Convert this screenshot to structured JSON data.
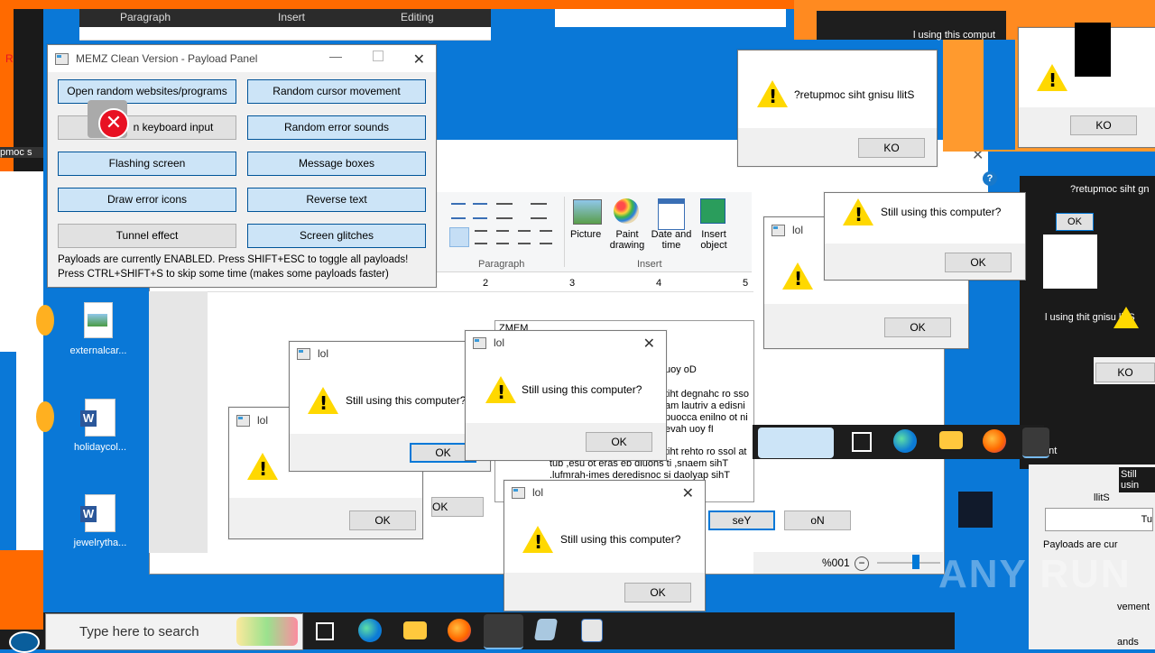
{
  "colors": {
    "desktop": "#0a78d7",
    "accent": "#0078d7",
    "warning": "#ffd800",
    "orange": "#ff6a00",
    "error_red": "#e81123"
  },
  "wordpad": {
    "tabs": [
      "Paragraph",
      "Insert",
      "Editing"
    ],
    "group_paragraph": "Paragraph",
    "group_insert": "Insert",
    "insert_items": [
      "Picture",
      "Paint drawing",
      "Date and time",
      "Insert object"
    ],
    "ruler_marks": [
      "2",
      "3",
      "4",
      "5"
    ],
    "zoom": "%001",
    "doc_lines": [
      "ZMEM",
      "uoy oD",
      "tiht degnahc ro sso",
      "am lautriv a edisni",
      "puocca enilno ot ni",
      "evah uoy fI",
      "tiht rehto ro ssol at",
      "tub ,esu ot eras eb dluohs ti ,snaem sihT",
      ".lufmrah-imes deredisnoc si daolyap sihT"
    ],
    "yes_label": "seY",
    "no_label": "oN"
  },
  "memz": {
    "title": "MEMZ Clean Version - Payload Panel",
    "buttons": [
      {
        "label": "Open random websites/programs",
        "on": true
      },
      {
        "label": "Random cursor movement",
        "on": true
      },
      {
        "label": "Random keyboard input",
        "on": false
      },
      {
        "label": "Random error sounds",
        "on": true
      },
      {
        "label": "Flashing screen",
        "on": true
      },
      {
        "label": "Message boxes",
        "on": true
      },
      {
        "label": "Draw error icons",
        "on": true
      },
      {
        "label": "Reverse text",
        "on": true
      },
      {
        "label": "Tunnel effect",
        "on": false
      },
      {
        "label": "Screen glitches",
        "on": true
      }
    ],
    "partial_keyboard_label": "n keyboard input",
    "status_1": "Payloads are currently ENABLED. Press SHIFT+ESC to toggle all payloads!",
    "status_2": "Press CTRL+SHIFT+S to skip some time (makes some payloads faster)"
  },
  "dialogs": {
    "title": "lol",
    "message": "Still using this computer?",
    "message_reversed": "?retupmoc siht gnisu llitS",
    "ok": "OK",
    "ok_reversed": "KO"
  },
  "desktop_icons": [
    {
      "label": "externalcar..."
    },
    {
      "label": "holidaycol..."
    },
    {
      "label": "jewelrytha..."
    }
  ],
  "taskbar": {
    "search_placeholder": "Type here to search"
  },
  "fragments": {
    "left_red_text": "R",
    "left_ko": "KO",
    "left_moc": "pmoc s",
    "payloads_are": "Payloads are cur",
    "still_usin": "Still usin",
    "still_using_thit": "l using thit gnisu llitS",
    "ent": "ent",
    "vement": "vement",
    "ands": "ands",
    "tu": "Tu",
    "llits": "llitS",
    "partial_rev_msg": "?retupmoc siht gn",
    "watermark": "ANY RUN",
    "right_top": "l using this comput"
  }
}
